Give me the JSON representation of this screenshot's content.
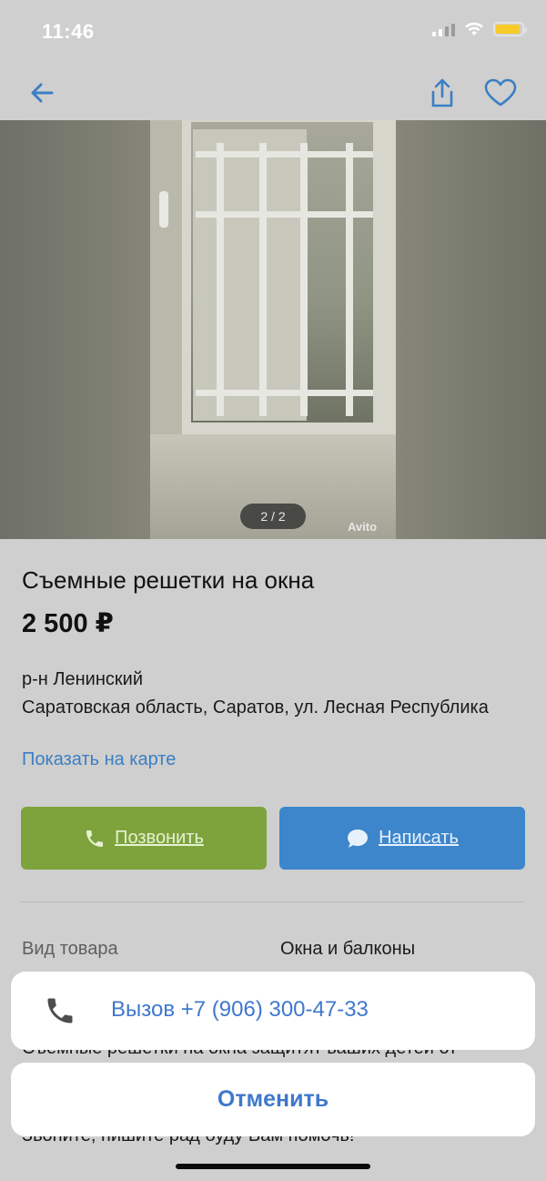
{
  "status_bar": {
    "time": "11:46"
  },
  "listing": {
    "photo_counter": "2 / 2",
    "photo_watermark": "Avito",
    "title": "Съемные решетки на окна",
    "price": "2 500 ₽",
    "address_line1": "р-н Ленинский",
    "address_line2": "Саратовская область, Саратов, ул. Лесная Республика",
    "map_link": "Показать на карте",
    "call_label": "Позвонить",
    "message_label": "Написать",
    "spec_label": "Вид товара",
    "spec_value": "Окна и балконы",
    "description_partial_1": "Съемные решетки на окна защитят ваших детей от",
    "description_partial_2": "Звоните, пишите рад буду Вам помочь!"
  },
  "action_sheet": {
    "call_option": "Вызов +7 (906) 300-47-33",
    "cancel": "Отменить"
  },
  "colors": {
    "accent_blue": "#3f78cc",
    "call_green": "#7ea33d",
    "message_blue": "#3d86cc"
  },
  "icons": [
    "back-arrow-icon",
    "share-icon",
    "heart-icon",
    "phone-icon",
    "chat-bubble-icon",
    "wifi-icon",
    "battery-icon",
    "signal-icon"
  ]
}
